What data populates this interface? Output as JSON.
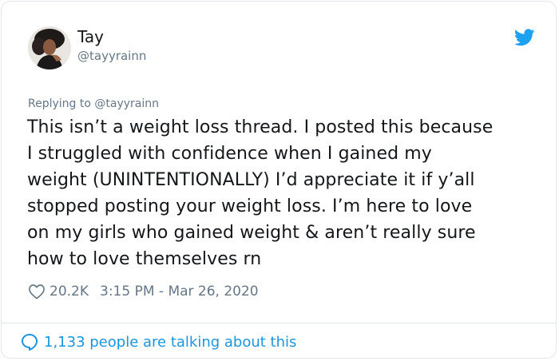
{
  "author": {
    "name": "Tay",
    "handle": "@tayyrainn"
  },
  "reply": {
    "prefix": "Replying to",
    "mention": "@tayyrainn"
  },
  "tweet": {
    "lines": [
      "This isn’t a weight loss thread. I posted this because",
      "I struggled with confidence when I gained my",
      "weight (UNINTENTIONALLY) I’d appreciate it if y’all",
      "stopped posting your weight loss. I’m here to love",
      "on my girls who gained weight & aren’t really sure",
      "how to love themselves rn"
    ]
  },
  "meta": {
    "likes": "20.2K",
    "timestamp": "3:15 PM - Mar 26, 2020"
  },
  "footer": {
    "conversation_text": "1,133 people are talking about this"
  },
  "icons": {
    "brand": "twitter-bird-icon",
    "like": "heart-outline-icon",
    "reply": "speech-bubble-icon"
  },
  "colors": {
    "brand_blue": "#1da1f2",
    "link_blue": "#1b95e0",
    "text": "#14171a",
    "muted": "#657786"
  }
}
